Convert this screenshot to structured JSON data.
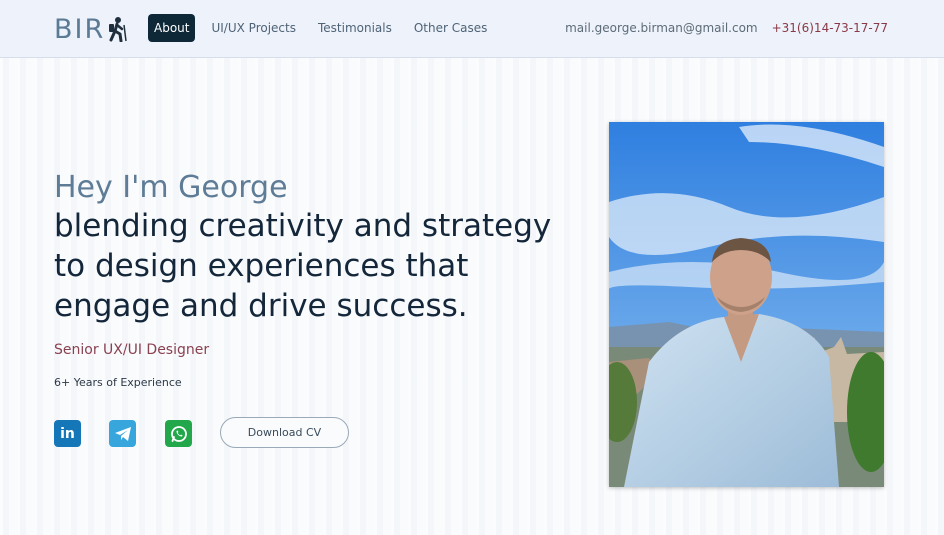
{
  "header": {
    "logo_text": "BIR",
    "nav": [
      {
        "label": "About",
        "active": true
      },
      {
        "label": "UI/UX Projects",
        "active": false
      },
      {
        "label": "Testimonials",
        "active": false
      },
      {
        "label": "Other Cases",
        "active": false
      }
    ],
    "email": "mail.george.birman@gmail.com",
    "phone": "+31(6)14-73-17-77"
  },
  "hero": {
    "greeting": "Hey I'm George",
    "headline": "blending creativity and strategy to design experiences that engage and drive success.",
    "role": "Senior UX/UI Designer",
    "experience": "6+ Years of Experience",
    "cv_button": "Download CV"
  },
  "social": [
    {
      "icon": "linkedin-icon",
      "label": "in",
      "color": "#1576b8"
    },
    {
      "icon": "telegram-icon",
      "color": "#37a6dd"
    },
    {
      "icon": "whatsapp-icon",
      "color": "#22a84a"
    }
  ],
  "colors": {
    "accent_dark": "#0e2838",
    "role_color": "#8a4150",
    "greeting_color": "#5e7c96"
  }
}
